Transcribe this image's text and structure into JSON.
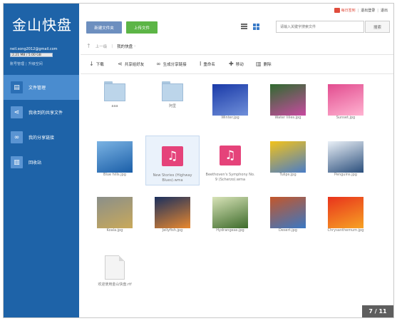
{
  "app": {
    "logo": "金山快盘",
    "email": "neil.song2012@gmail.com",
    "quota_text": "2.21 MB / 5.00 GB",
    "quota_fraction": 0.0004,
    "links": [
      "账号管理",
      "升级空间"
    ]
  },
  "toplinks": {
    "signin": "每日签到",
    "switch": "退出登录",
    "logout": "退出"
  },
  "buttons": {
    "new_folder": "新建文件夹",
    "upload": "上传文件"
  },
  "search": {
    "placeholder": "请输入关键字搜索文件",
    "button": "搜索"
  },
  "breadcrumb": {
    "prev": "上一级",
    "current": "我的快盘"
  },
  "toolbar": [
    {
      "icon": "download-icon",
      "label": "下载"
    },
    {
      "icon": "share-icon",
      "label": "共享给好友"
    },
    {
      "icon": "link-icon",
      "label": "生成分享链接"
    },
    {
      "icon": "rename-icon",
      "label": "重命名"
    },
    {
      "icon": "move-icon",
      "label": "移动"
    },
    {
      "icon": "delete-icon",
      "label": "删除"
    }
  ],
  "sidebar": {
    "items": [
      {
        "label": "文件管理",
        "icon": "file-icon",
        "active": true
      },
      {
        "label": "我收到的共享文件",
        "icon": "share-icon",
        "active": false
      },
      {
        "label": "我的分享链接",
        "icon": "link-icon",
        "active": false
      },
      {
        "label": "回收站",
        "icon": "trash-icon",
        "active": false
      }
    ]
  },
  "files": [
    {
      "name": "aaa",
      "kind": "folder"
    },
    {
      "name": "阿里",
      "kind": "folder"
    },
    {
      "name": "Winter.jpg",
      "kind": "image",
      "colors": [
        "#1a3aa8",
        "#6f8fd9"
      ]
    },
    {
      "name": "Water lilies.jpg",
      "kind": "image",
      "colors": [
        "#2f6b2f",
        "#c84aa0"
      ]
    },
    {
      "name": "Sunset.jpg",
      "kind": "image",
      "colors": [
        "#e24c8f",
        "#ffb3d1"
      ]
    },
    {
      "name": "Blue hills.jpg",
      "kind": "image",
      "colors": [
        "#7bb3e3",
        "#1a5ea8"
      ]
    },
    {
      "name": "New Stories (Highway Blues).wma",
      "kind": "music",
      "selected": true
    },
    {
      "name": "Beethoven's Symphony No. 9 (Scherzo).wma",
      "kind": "music"
    },
    {
      "name": "Tulips.jpg",
      "kind": "image",
      "colors": [
        "#f2c21b",
        "#4a7dc7"
      ]
    },
    {
      "name": "Penguins.jpg",
      "kind": "image",
      "colors": [
        "#eaf0f7",
        "#2b4f7c"
      ]
    },
    {
      "name": "Koala.jpg",
      "kind": "image",
      "colors": [
        "#8a8f8a",
        "#c9a95a"
      ]
    },
    {
      "name": "Jellyfish.jpg",
      "kind": "image",
      "colors": [
        "#1a2f5e",
        "#e8882f"
      ]
    },
    {
      "name": "Hydrangeas.jpg",
      "kind": "image",
      "colors": [
        "#d8e3b8",
        "#3d6b2a"
      ]
    },
    {
      "name": "Desert.jpg",
      "kind": "image",
      "colors": [
        "#c4562a",
        "#3a78c4"
      ]
    },
    {
      "name": "Chrysanthemum.jpg",
      "kind": "image",
      "colors": [
        "#e8331c",
        "#f7a224"
      ]
    },
    {
      "name": "欢迎使用金山快盘.rtf",
      "kind": "doc"
    }
  ],
  "pager": "7 / 11"
}
